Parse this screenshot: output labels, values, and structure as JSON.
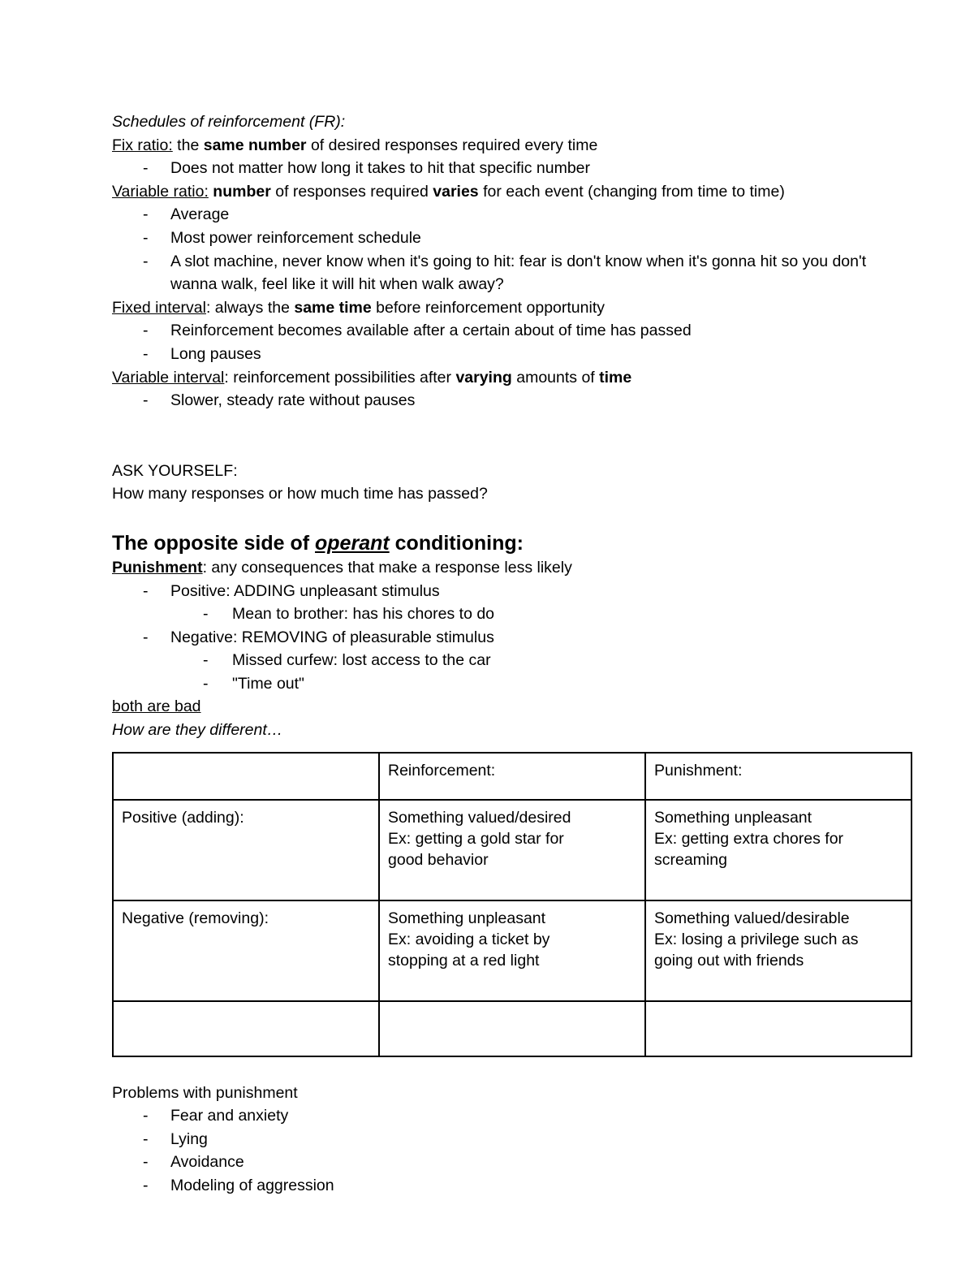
{
  "document": {
    "section_schedules": {
      "title": "Schedules of reinforcement (FR):",
      "fix_ratio_label": "Fix ratio:",
      "fix_ratio_rest_1": " the ",
      "fix_ratio_bold": "same number",
      "fix_ratio_rest_2": " of desired responses required every time",
      "fix_ratio_bullets": [
        "Does not matter how long it takes to hit that specific number"
      ],
      "variable_ratio_label": "Variable ratio:",
      "variable_ratio_rest_1": " ",
      "variable_ratio_bold_1": "number",
      "variable_ratio_rest_2": " of responses required ",
      "variable_ratio_bold_2": "varies",
      "variable_ratio_rest_3": " for each event (changing from time to time)",
      "variable_ratio_bullets": [
        "Average",
        "Most power reinforcement schedule",
        "A slot machine, never know when it's going to hit: fear is don't know when it's gonna hit so you don't wanna walk, feel like it will hit when walk away?"
      ],
      "fixed_interval_label": "Fixed interval",
      "fixed_interval_rest_1": ": always the ",
      "fixed_interval_bold": "same time",
      "fixed_interval_rest_2": " before reinforcement opportunity",
      "fixed_interval_bullets": [
        "Reinforcement becomes available after a certain about of time has passed",
        "Long pauses"
      ],
      "variable_interval_label": "Variable interval",
      "variable_interval_rest_1": ": reinforcement possibilities after ",
      "variable_interval_bold_1": "varying",
      "variable_interval_rest_2": " amounts of ",
      "variable_interval_bold_2": "time",
      "variable_interval_bullets": [
        "Slower, steady rate without pauses"
      ]
    },
    "section_ask": {
      "prompt_label": "ASK YOURSELF:",
      "prompt_question": "How many responses or how much time has passed?"
    },
    "section_punishment": {
      "heading_part_1": "The opposite side of ",
      "heading_emphasis": "operant",
      "heading_part_2": " conditioning:",
      "punishment_label": "Punishment",
      "punishment_rest": ": any consequences that make a response less likely",
      "positive_item": "Positive: ADDING unpleasant stimulus",
      "positive_sub": [
        "Mean to brother: has his chores to do"
      ],
      "negative_item": "Negative: REMOVING of pleasurable stimulus",
      "negative_sub": [
        "Missed curfew: lost access to the car",
        "\"Time out\""
      ],
      "both_are_bad": "both are bad ",
      "how_different": "How are they different…"
    },
    "comparison_table": {
      "headers": [
        "",
        "Reinforcement:",
        "Punishment:"
      ],
      "rows": [
        {
          "label": "Positive (adding):",
          "reinforcement": [
            "Something valued/desired",
            "Ex: getting a gold star for",
            "good behavior"
          ],
          "punishment": [
            "Something unpleasant",
            "Ex: getting extra chores for",
            "screaming"
          ]
        },
        {
          "label": "Negative (removing):",
          "reinforcement": [
            "Something unpleasant",
            "Ex: avoiding a ticket by",
            "stopping at a red light"
          ],
          "punishment": [
            "Something valued/desirable",
            "Ex: losing a privilege such as",
            "going out with friends"
          ]
        },
        {
          "label": "",
          "reinforcement": [
            ""
          ],
          "punishment": [
            ""
          ]
        }
      ]
    },
    "section_problems": {
      "title": "Problems with punishment",
      "items": [
        "Fear and anxiety",
        "Lying",
        "Avoidance",
        "Modeling of aggression"
      ]
    },
    "colors": {
      "text": "#000000",
      "page_background": "#ffffff",
      "table_border": "#000000"
    }
  }
}
